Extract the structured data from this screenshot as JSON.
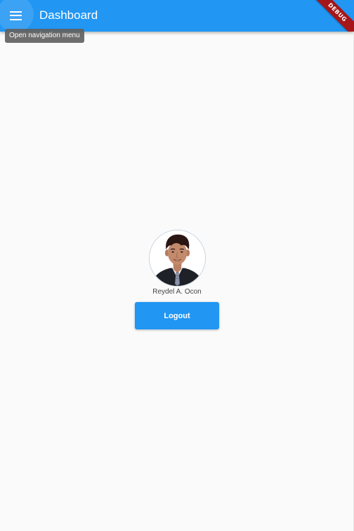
{
  "app_bar": {
    "title": "Dashboard",
    "menu_icon": "menu-icon",
    "menu_tooltip": "Open navigation menu",
    "background_color": "#2196f3",
    "debug_banner": "DEBUG"
  },
  "profile": {
    "name": "Reydel A. Ocon",
    "logout_label": "Logout",
    "button_color": "#2196f3"
  }
}
